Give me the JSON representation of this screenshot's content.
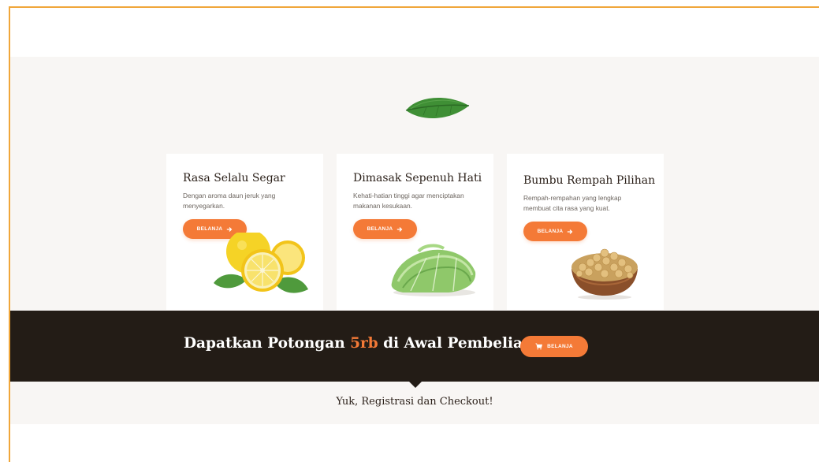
{
  "features": {
    "cards": [
      {
        "title": "Rasa Selalu Segar",
        "description": "Dengan aroma daun jeruk yang menyegarkan.",
        "button_label": "BELANJA",
        "image_icon": "lemon-icon"
      },
      {
        "title": "Dimasak Sepenuh Hati",
        "description": "Kehati-hatian tinggi agar menciptakan makanan kesukaan.",
        "button_label": "BELANJA",
        "image_icon": "lettuce-icon"
      },
      {
        "title": "Bumbu Rempah Pilihan",
        "description": "Rempah-rempahan yang lengkap membuat cita rasa yang kuat.",
        "button_label": "BELANJA",
        "image_icon": "soybean-bowl-icon"
      }
    ]
  },
  "promo": {
    "text_before": "Dapatkan Potongan ",
    "highlight": "5rb",
    "text_after": " di Awal Pembelian!",
    "button_label": "BELANJA",
    "button_icon": "cart-icon"
  },
  "register": {
    "text": "Yuk, Registrasi dan Checkout!"
  },
  "colors": {
    "accent": "#f47a37",
    "dark_band": "#231c16",
    "section_bg": "#f8f6f4",
    "frame_border": "#f0a63a"
  }
}
